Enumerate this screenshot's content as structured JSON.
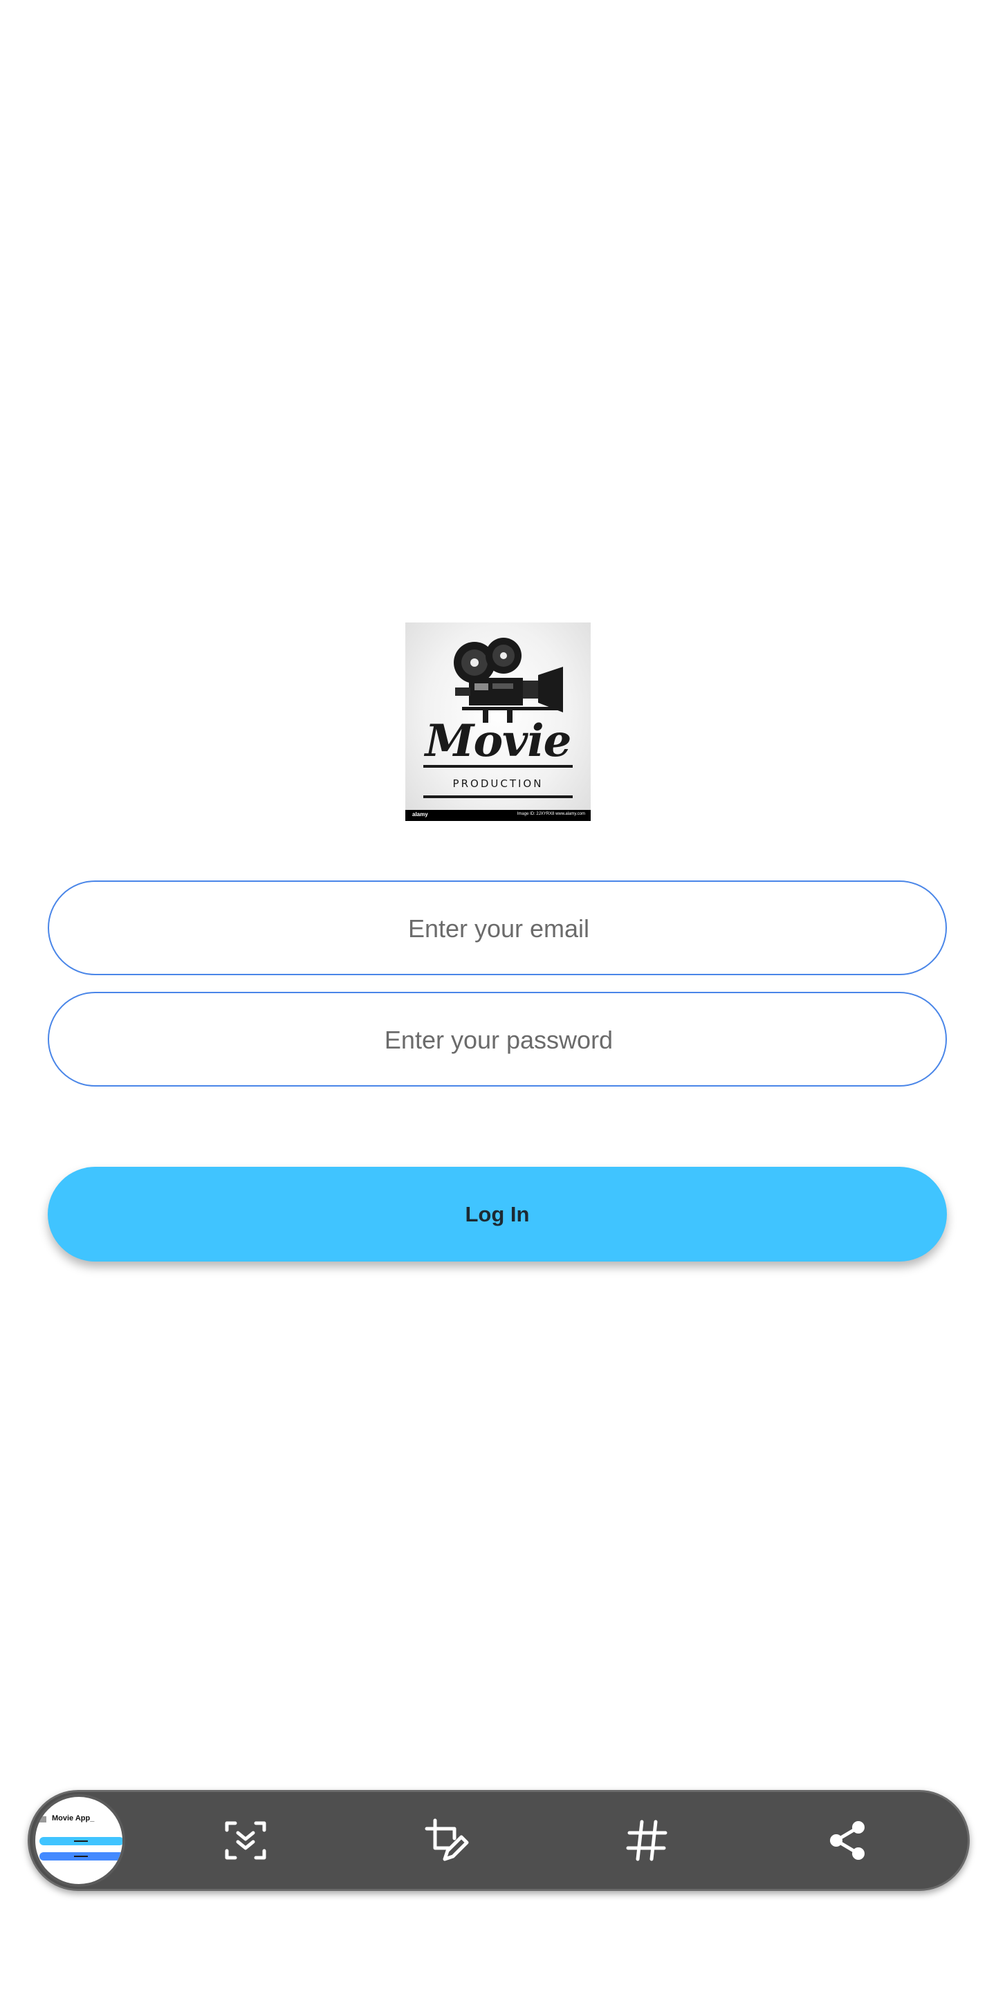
{
  "logo": {
    "title": "Movie",
    "subtitle": "PRODUCTION",
    "watermark_brand": "alamy",
    "watermark_id": "Image ID: 2JXYRX8 www.alamy.com"
  },
  "login_form": {
    "email_placeholder": "Enter your email",
    "password_placeholder": "Enter your password",
    "login_label": "Log In"
  },
  "toolbar": {
    "thumbnail_title": "Movie App_",
    "buttons": [
      {
        "icon": "scroll-capture-icon"
      },
      {
        "icon": "crop-edit-icon"
      },
      {
        "icon": "hashtag-icon"
      },
      {
        "icon": "share-icon"
      }
    ]
  },
  "colors": {
    "field_border": "#4a86e8",
    "login_button": "#40c4ff",
    "toolbar_background": "#4f4f4f",
    "page_background": "#ffffff"
  }
}
